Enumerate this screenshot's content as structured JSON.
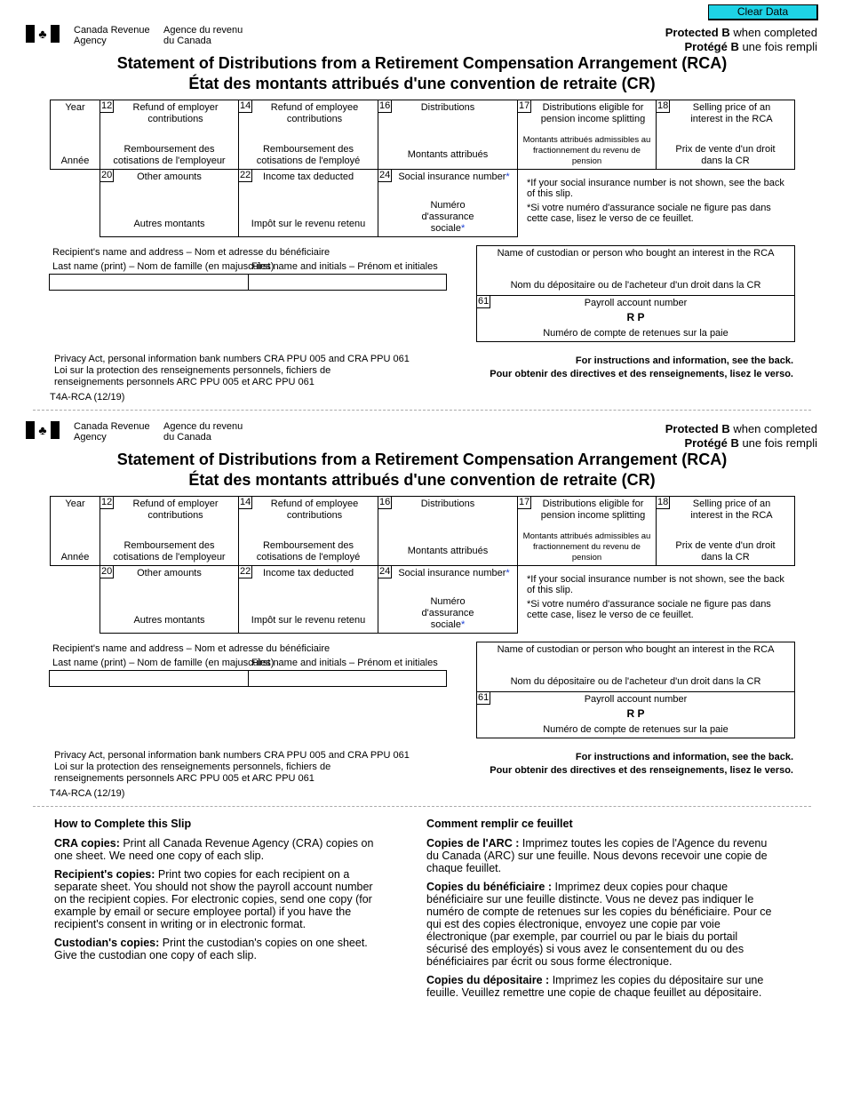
{
  "toolbar": {
    "clear_label": "Clear Data"
  },
  "slip": {
    "agency_en_line1": "Canada Revenue",
    "agency_en_line2": "Agency",
    "agency_fr_line1": "Agence du revenu",
    "agency_fr_line2": "du Canada",
    "protected_en_bold": "Protected B",
    "protected_en_rest": " when completed",
    "protected_fr_bold": "Protégé B",
    "protected_fr_rest": " une fois rempli",
    "title_en": "Statement of Distributions from a Retirement Compensation Arrangement (RCA)",
    "title_fr": "État des montants attribués d'une convention de retraite (CR)",
    "year": {
      "en": "Year",
      "fr": "Année"
    },
    "box12": {
      "num": "12",
      "en": "Refund of employer contributions",
      "fr": "Remboursement des cotisations de l'employeur"
    },
    "box14": {
      "num": "14",
      "en": "Refund of employee contributions",
      "fr": "Remboursement des cotisations de l'employé"
    },
    "box16": {
      "num": "16",
      "en": "Distributions",
      "fr": "Montants attribués"
    },
    "box17": {
      "num": "17",
      "en": "Distributions eligible for pension income splitting",
      "fr": "Montants attribués admissibles au fractionnement du revenu de pension"
    },
    "box18": {
      "num": "18",
      "en": "Selling price of an interest in the RCA",
      "fr": "Prix de vente d'un droit dans la CR"
    },
    "box20": {
      "num": "20",
      "en": "Other amounts",
      "fr": "Autres montants"
    },
    "box22": {
      "num": "22",
      "en": "Income tax deducted",
      "fr": "Impôt sur le revenu retenu"
    },
    "box24": {
      "num": "24",
      "en": "Social insurance number",
      "fr": "Numéro d'assurance sociale",
      "star": "*"
    },
    "sin_note_en": "*If your social insurance number is not shown, see the back of this slip.",
    "sin_note_fr": "*Si votre numéro d'assurance sociale ne figure pas dans cette case, lisez le verso de ce feuillet.",
    "recipient_label": "Recipient's name and address  –  Nom et adresse du bénéficiaire",
    "last_name_label": "Last name (print)  –  Nom de famille (en majuscules)",
    "first_name_label": "First name and initials  –  Prénom et initiales",
    "last_name_value": "",
    "first_name_value": "",
    "custodian_en": "Name of custodian or person who bought an interest in the RCA",
    "custodian_fr": "Nom du dépositaire ou de l'acheteur d'un droit dans la CR",
    "box61": {
      "num": "61",
      "en": "Payroll account number",
      "value": "R P",
      "fr": "Numéro de compte de retenues sur la paie"
    },
    "privacy_line1": "Privacy Act, personal information bank numbers CRA PPU 005 and CRA PPU 061",
    "privacy_line2": "Loi sur la protection des renseignements personnels, fichiers de",
    "privacy_line3": "renseignements personnels ARC PPU 005 et ARC PPU 061",
    "instructions_en": "For instructions and information, see the back.",
    "instructions_fr": "Pour obtenir des directives et des renseignements, lisez le verso.",
    "form_number": "T4A-RCA (12/19)"
  },
  "how_to": {
    "en": {
      "title": "How to Complete this Slip",
      "items": [
        {
          "bold": "CRA copies:",
          "text": " Print all Canada Revenue Agency (CRA) copies on one sheet. We need one copy of each slip."
        },
        {
          "bold": "Recipient's copies:",
          "text": " Print two copies for each recipient on a separate sheet. You should not show the payroll account number on the recipient copies. For electronic copies, send one copy (for example by email or secure employee portal) if you have the recipient's consent in writing or in electronic format."
        },
        {
          "bold": "Custodian's copies:",
          "text": " Print the custodian's copies on one sheet. Give the custodian one copy of each slip."
        }
      ]
    },
    "fr": {
      "title": "Comment remplir ce feuillet",
      "items": [
        {
          "bold": "Copies de l'ARC :",
          "text": " Imprimez toutes les copies de l'Agence du revenu du Canada (ARC) sur une feuille. Nous devons recevoir une copie de chaque feuillet."
        },
        {
          "bold": "Copies du bénéficiaire :",
          "text": " Imprimez deux copies pour chaque bénéficiaire sur une feuille distincte. Vous ne devez pas indiquer le numéro de compte de retenues sur les copies du bénéficiaire. Pour ce qui est des copies électronique, envoyez une copie par voie électronique (par exemple, par courriel ou par le biais du portail sécurisé des employés) si vous avez le consentement du ou des bénéficiaires par écrit ou sous forme électronique."
        },
        {
          "bold": "Copies du dépositaire :",
          "text": " Imprimez les copies du dépositaire sur une feuille. Veuillez remettre une copie de chaque feuillet au dépositaire."
        }
      ]
    }
  }
}
